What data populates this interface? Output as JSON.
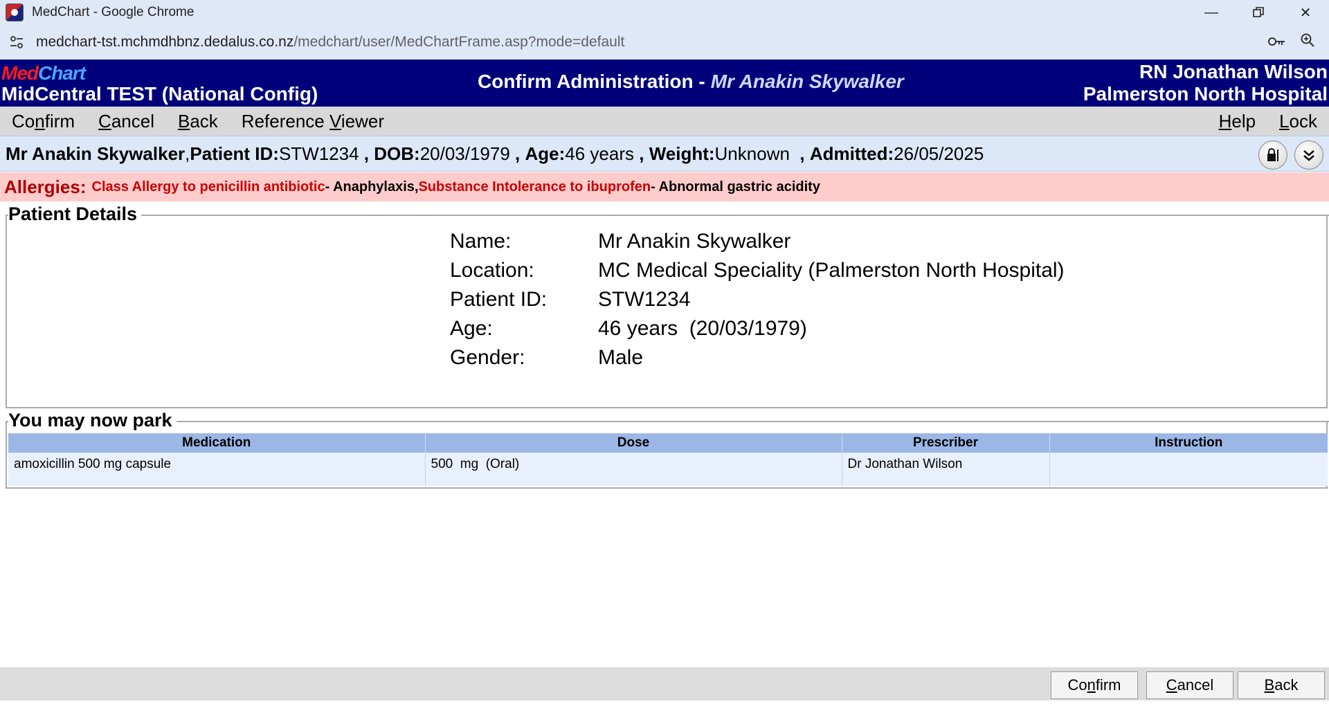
{
  "browser": {
    "window_title": "MedChart - Google Chrome",
    "url_host": "medchart-tst.mchmdhbnz.dedalus.co.nz",
    "url_path": "/medchart/user/MedChartFrame.asp?mode=default"
  },
  "header": {
    "logo_med": "Med",
    "logo_chart": "Chart",
    "site": "MidCentral TEST (National Config)",
    "title": "Confirm Administration -",
    "patient_name": "Mr Anakin Skywalker",
    "user": "RN Jonathan Wilson",
    "hospital": "Palmerston North Hospital"
  },
  "menu": {
    "confirm_pre": "Co",
    "confirm_u": "n",
    "confirm_post": "firm",
    "cancel_u": "C",
    "cancel_post": "ancel",
    "back_u": "B",
    "back_post": "ack",
    "refviewer_pre": "Reference ",
    "refviewer_u": "V",
    "refviewer_post": "iewer",
    "help_u": "H",
    "help_post": "elp",
    "lock_u": "L",
    "lock_post": "ock"
  },
  "banner": {
    "name": "Mr Anakin Skywalker",
    "sep": " , ",
    "pid_label": "Patient ID:",
    "pid": "STW1234",
    "dob_label": "DOB:",
    "dob": "20/03/1979",
    "age_label": "Age:",
    "age": "46 years",
    "weight_label": "Weight:",
    "weight": "Unknown",
    "admitted_label": "Admitted:",
    "admitted": "26/05/2025"
  },
  "allergies": {
    "label": "Allergies:",
    "a1": "Class Allergy to penicillin antibiotic",
    "r1": " - Anaphylaxis",
    "comma": ", ",
    "a2": "Substance Intolerance to ibuprofen",
    "r2": " - Abnormal gastric acidity"
  },
  "patient_details": {
    "legend": "Patient Details",
    "rows": [
      {
        "k": "Name:",
        "v": "Mr Anakin Skywalker"
      },
      {
        "k": "Location:",
        "v": "MC Medical Speciality (Palmerston North Hospital)"
      },
      {
        "k": "Patient ID:",
        "v": "STW1234"
      },
      {
        "k": "Age:",
        "v": "46 years  (20/03/1979)"
      },
      {
        "k": "Gender:",
        "v": "Male"
      }
    ]
  },
  "park": {
    "legend": "You may now park",
    "columns": [
      "Medication",
      "Dose",
      "Prescriber",
      "Instruction"
    ],
    "rows": [
      [
        "amoxicillin 500 mg capsule",
        "500  mg  (Oral)",
        "Dr Jonathan Wilson",
        ""
      ]
    ]
  },
  "footer": {
    "confirm_pre": "Co",
    "confirm_u": "n",
    "confirm_post": "firm",
    "cancel_u": "C",
    "cancel_post": "ancel",
    "back_u": "B",
    "back_post": "ack"
  }
}
